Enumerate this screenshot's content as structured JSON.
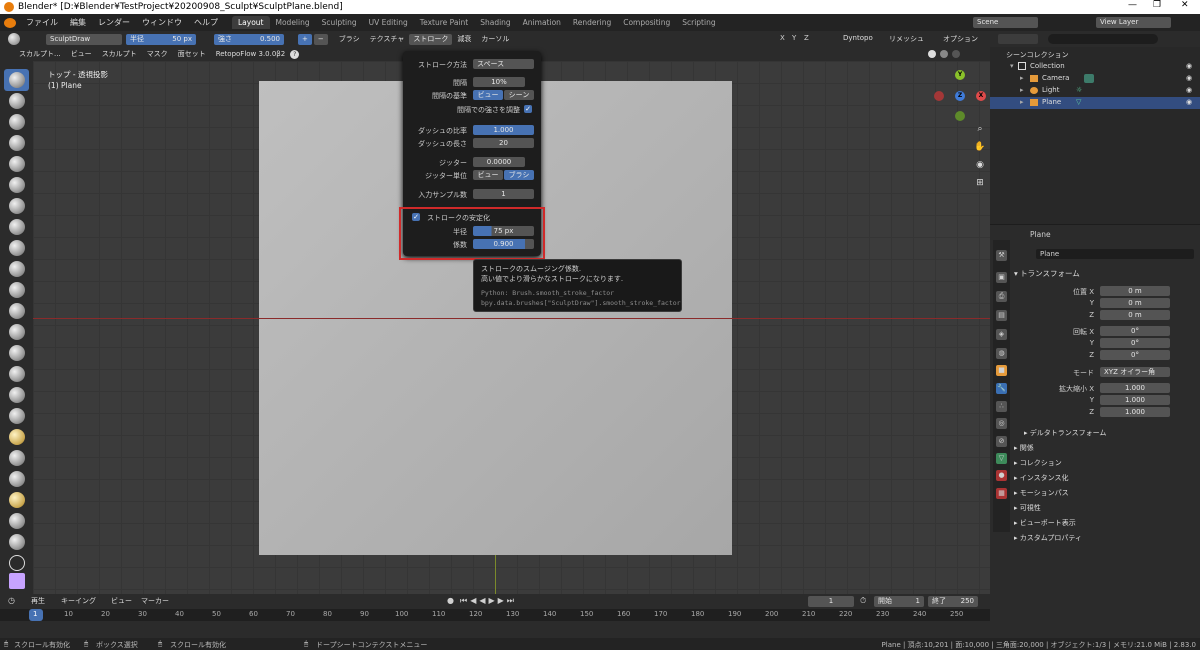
{
  "window": {
    "title": "Blender* [D:¥Blender¥TestProject¥20200908_Sculpt¥SculptPlane.blend]",
    "controls": [
      "—",
      "❐",
      "✕"
    ]
  },
  "menubar": {
    "menus": [
      "ファイル",
      "編集",
      "レンダー",
      "ウィンドウ",
      "ヘルプ"
    ],
    "workspaces": [
      "Layout",
      "Modeling",
      "Sculpting",
      "UV Editing",
      "Texture Paint",
      "Shading",
      "Animation",
      "Rendering",
      "Compositing",
      "Scripting"
    ],
    "active_workspace": "Layout",
    "scene": "Scene",
    "view_layer": "View Layer"
  },
  "tool_header": {
    "brush_name": "SculptDraw",
    "radius_label": "半径",
    "radius_value": "50 px",
    "strength_label": "強さ",
    "strength_value": "0.500",
    "plus": "+",
    "minus": "−",
    "brush_menu": "ブラシ",
    "texture_menu": "テクスチャ",
    "stroke_menu": "ストローク",
    "falloff_menu": "減衰",
    "cursor_menu": "カーソル",
    "axes": [
      "X",
      "Y",
      "Z"
    ],
    "dyntopo": "Dyntopo",
    "remesh": "リメッシュ",
    "options": "オプション"
  },
  "viewport_header": {
    "mode_label": "スカルプト...",
    "menus": [
      "ビュー",
      "スカルプト",
      "マスク",
      "面セット"
    ],
    "addon": "RetopoFlow 3.0.0β2"
  },
  "viewport": {
    "view_name": "トップ - 透視投影",
    "object_name": "(1) Plane"
  },
  "stroke_popup": {
    "method_label": "ストローク方法",
    "method_value": "スペース",
    "spacing_label": "間隔",
    "spacing_value": "10%",
    "spacing_basis_label": "間隔の基準",
    "basis_view": "ビュー",
    "basis_scene": "シーン",
    "adjust_strength": "間隔での強さを調整",
    "dash_ratio_label": "ダッシュの比率",
    "dash_ratio_value": "1.000",
    "dash_length_label": "ダッシュの長さ",
    "dash_length_value": "20",
    "jitter_label": "ジッター",
    "jitter_value": "0.0000",
    "jitter_unit_label": "ジッター単位",
    "unit_view": "ビュー",
    "unit_brush": "ブラシ",
    "input_samples_label": "入力サンプル数",
    "input_samples_value": "1",
    "stabilize_label": "ストロークの安定化",
    "stabilize_radius_label": "半径",
    "stabilize_radius_value": "75 px",
    "stabilize_factor_label": "係数",
    "stabilize_factor_value": "0.900"
  },
  "tooltip": {
    "line1": "ストロークのスムージング係数.",
    "line2": "高い値でより滑らかなストロークになります.",
    "python1": "Python: Brush.smooth_stroke_factor",
    "python2": "bpy.data.brushes[\"SculptDraw\"].smooth_stroke_factor"
  },
  "outliner": {
    "root": "シーンコレクション",
    "items": [
      {
        "name": "Collection",
        "indent": 1
      },
      {
        "name": "Camera",
        "indent": 2
      },
      {
        "name": "Light",
        "indent": 2
      },
      {
        "name": "Plane",
        "indent": 2
      }
    ]
  },
  "properties": {
    "object_name": "Plane",
    "data_name": "Plane",
    "transform_header": "トランスフォーム",
    "location_label": "位置 X",
    "location": [
      "0 m",
      "0 m",
      "0 m"
    ],
    "rotation_label": "回転 X",
    "rotation": [
      "0°",
      "0°",
      "0°"
    ],
    "mode_label": "モード",
    "mode_value": "XYZ オイラー角",
    "scale_label": "拡大縮小 X",
    "scale": [
      "1.000",
      "1.000",
      "1.000"
    ],
    "y_label": "Y",
    "z_label": "Z",
    "delta_transform": "デルタトランスフォーム",
    "sections": [
      "関係",
      "コレクション",
      "インスタンス化",
      "モーションパス",
      "可視性",
      "ビューポート表示",
      "カスタムプロパティ"
    ]
  },
  "timeline": {
    "menus": [
      "再生",
      "キーイング",
      "ビュー",
      "マーカー"
    ],
    "current_frame": "1",
    "start_label": "開始",
    "start_value": "1",
    "end_label": "終了",
    "end_value": "250",
    "frame_numbers": [
      "1",
      "10",
      "20",
      "30",
      "40",
      "50",
      "60",
      "70",
      "80",
      "90",
      "100",
      "110",
      "120",
      "130",
      "140",
      "150",
      "160",
      "170",
      "180",
      "190",
      "200",
      "210",
      "220",
      "230",
      "240",
      "250"
    ]
  },
  "statusbar": {
    "items": [
      "スクロール有効化",
      "ボックス選択",
      "スクロール有効化",
      "ドープシートコンテクストメニュー"
    ],
    "right": "Plane | 頂点:10,201 | 面:10,000 | 三角面:20,000 | オブジェクト:1/3 | メモリ:21.0 MiB | 2.83.0"
  },
  "colors": {
    "accent": "#4772b3",
    "highlight_border": "#d02a2a",
    "plane": "#b4b4b4"
  }
}
